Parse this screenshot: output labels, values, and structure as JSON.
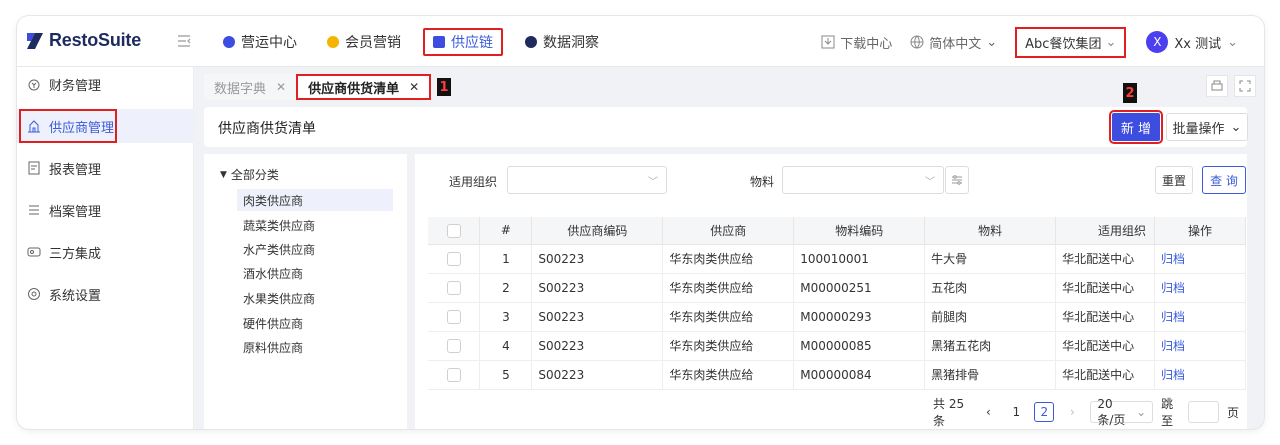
{
  "app": {
    "name": "RestoSuite"
  },
  "nav": {
    "items": [
      {
        "label": "营运中心"
      },
      {
        "label": "会员营销"
      },
      {
        "label": "供应链"
      },
      {
        "label": "数据洞察"
      }
    ]
  },
  "header": {
    "download": "下载中心",
    "language": "简体中文",
    "org": "Abc餐饮集团",
    "user_initial": "X",
    "user": "Xx 测试"
  },
  "sidebar": {
    "items": [
      {
        "label": "财务管理"
      },
      {
        "label": "供应商管理"
      },
      {
        "label": "报表管理"
      },
      {
        "label": "档案管理"
      },
      {
        "label": "三方集成"
      },
      {
        "label": "系统设置"
      }
    ]
  },
  "tabs": [
    {
      "label": "数据字典"
    },
    {
      "label": "供应商供货清单"
    }
  ],
  "markers": {
    "one": "1",
    "two": "2"
  },
  "page": {
    "title": "供应商供货清单",
    "new_label": "新 增",
    "batch_label": "批量操作"
  },
  "tree": {
    "root": "全部分类",
    "nodes": [
      "肉类供应商",
      "蔬菜类供应商",
      "水产类供应商",
      "酒水供应商",
      "水果类供应商",
      "硬件供应商",
      "原料供应商"
    ]
  },
  "filters": {
    "org_label": "适用组织",
    "material_label": "物料",
    "reset": "重置",
    "query": "查 询"
  },
  "table": {
    "headers": [
      "#",
      "供应商编码",
      "供应商",
      "物料编码",
      "物料",
      "适用组织",
      "操作"
    ],
    "rows": [
      {
        "idx": "1",
        "code": "S00223",
        "supplier": "华东肉类供应给",
        "mcode": "100010001",
        "material": "牛大骨",
        "org": "华北配送中心",
        "action": "归档"
      },
      {
        "idx": "2",
        "code": "S00223",
        "supplier": "华东肉类供应给",
        "mcode": "M00000251",
        "material": "五花肉",
        "org": "华北配送中心",
        "action": "归档"
      },
      {
        "idx": "3",
        "code": "S00223",
        "supplier": "华东肉类供应给",
        "mcode": "M00000293",
        "material": "前腿肉",
        "org": "华北配送中心",
        "action": "归档"
      },
      {
        "idx": "4",
        "code": "S00223",
        "supplier": "华东肉类供应给",
        "mcode": "M00000085",
        "material": "黑猪五花肉",
        "org": "华北配送中心",
        "action": "归档"
      },
      {
        "idx": "5",
        "code": "S00223",
        "supplier": "华东肉类供应给",
        "mcode": "M00000084",
        "material": "黑猪排骨",
        "org": "华北配送中心",
        "action": "归档"
      }
    ]
  },
  "pagination": {
    "total": "共 25 条",
    "page1": "1",
    "page2": "2",
    "size": "20 条/页",
    "jump": "跳至",
    "page_unit": "页"
  },
  "colors": {
    "accent": "#3b5bdb",
    "highlight": "#e02020"
  }
}
